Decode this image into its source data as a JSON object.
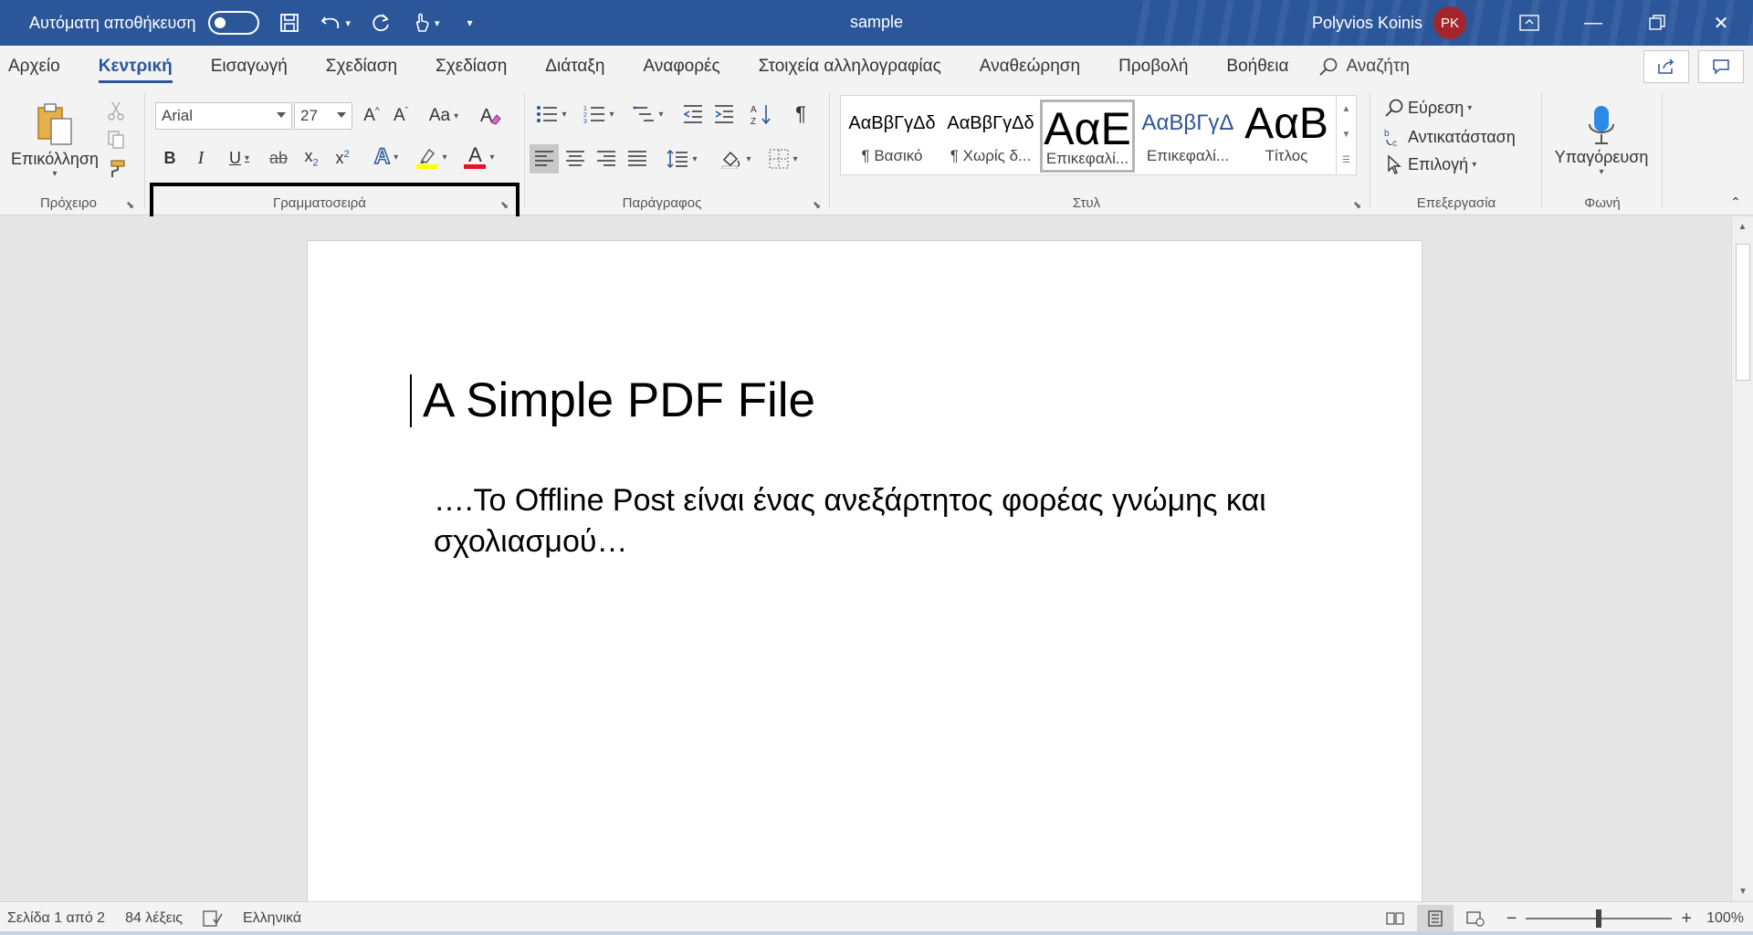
{
  "titlebar": {
    "autosave_label": "Αυτόματη αποθήκευση",
    "doc_title": "sample",
    "user_name": "Polyvios Koinis",
    "user_initials": "PK"
  },
  "tabs": [
    {
      "label": "Αρχείο",
      "active": false
    },
    {
      "label": "Κεντρική",
      "active": true
    },
    {
      "label": "Εισαγωγή",
      "active": false
    },
    {
      "label": "Σχεδίαση",
      "active": false
    },
    {
      "label": "Σχεδίαση",
      "active": false
    },
    {
      "label": "Διάταξη",
      "active": false
    },
    {
      "label": "Αναφορές",
      "active": false
    },
    {
      "label": "Στοιχεία αλληλογραφίας",
      "active": false
    },
    {
      "label": "Αναθεώρηση",
      "active": false
    },
    {
      "label": "Προβολή",
      "active": false
    },
    {
      "label": "Βοήθεια",
      "active": false
    }
  ],
  "search_label": "Αναζήτη",
  "ribbon": {
    "clipboard": {
      "paste_label": "Επικόλληση",
      "group_label": "Πρόχειρο"
    },
    "font": {
      "font_name": "Arial",
      "font_size": "27",
      "group_label": "Γραμματοσειρά",
      "highlight_color": "#ffff00",
      "font_color": "#e81123"
    },
    "paragraph": {
      "group_label": "Παράγραφος"
    },
    "styles": {
      "group_label": "Στυλ",
      "items": [
        {
          "sample": "ΑαΒβΓγΔδ",
          "name": "¶ Βασικό",
          "selected": false
        },
        {
          "sample": "ΑαΒβΓγΔδ",
          "name": "¶ Χωρίς δ...",
          "selected": false
        },
        {
          "sample": "ΑαΕ",
          "name": "Επικεφαλί...",
          "selected": true
        },
        {
          "sample": "ΑαΒβΓγΔ",
          "name": "Επικεφαλί...",
          "selected": false
        },
        {
          "sample": "ΑαΒ",
          "name": "Τίτλος",
          "selected": false
        }
      ]
    },
    "editing": {
      "group_label": "Επεξεργασία",
      "find": "Εύρεση",
      "replace": "Αντικατάσταση",
      "select": "Επιλογή"
    },
    "voice": {
      "group_label": "Φωνή",
      "dictate": "Υπαγόρευση"
    }
  },
  "document": {
    "heading": "A Simple PDF File",
    "paragraph": "….Το Offline Post είναι ένας ανεξάρτητος φορέας γνώμης και σχολιασμού…"
  },
  "statusbar": {
    "page": "Σελίδα 1 από 2",
    "words": "84 λέξεις",
    "language": "Ελληνικά",
    "zoom": "100%",
    "zoom_fraction": 0.5
  },
  "colors": {
    "accent": "#2b579a",
    "avatar": "#a4262c"
  }
}
